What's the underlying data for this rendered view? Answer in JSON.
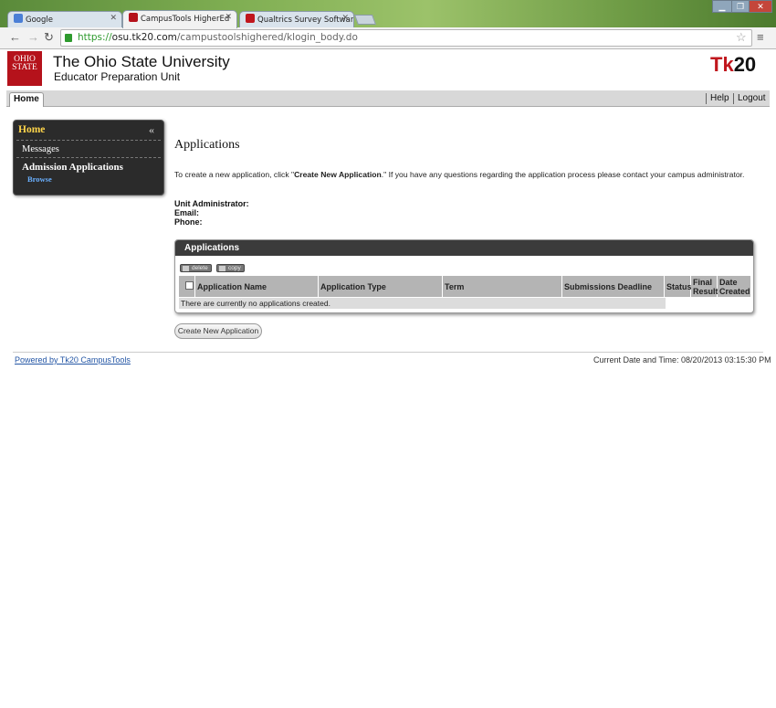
{
  "browser": {
    "tabs": [
      {
        "label": "Google",
        "icon": "google-icon",
        "color": "#4a7fd6"
      },
      {
        "label": "CampusTools HigherEd",
        "icon": "feather-icon",
        "color": "#b5121b"
      },
      {
        "label": "Qualtrics Survey Software",
        "icon": "qualtrics-icon",
        "color": "#c0161d"
      }
    ],
    "url_scheme": "https://",
    "url_host": "osu.tk20.com",
    "url_path": "/campustoolshighered/klogin_body.do"
  },
  "header": {
    "logo_text": "OHIO STATE",
    "university": "The Ohio State University",
    "unit": "Educator Preparation Unit",
    "brand_tk": "Tk",
    "brand_20": "20"
  },
  "menubar": {
    "home_tab": "Home",
    "help": "Help",
    "logout": "Logout"
  },
  "sidebar": {
    "home": "Home",
    "messages": "Messages",
    "admission": "Admission Applications",
    "browse": "Browse"
  },
  "main": {
    "heading": "Applications",
    "intro_before": "To create a new application, click \"",
    "intro_bold": "Create New Application",
    "intro_after": ".\" If you have any questions regarding the application process please contact your campus administrator.",
    "unit_admin": "Unit Administrator:",
    "email": "Email:",
    "phone": "Phone:"
  },
  "applications_box": {
    "title": "Applications",
    "delete_label": "delete",
    "copy_label": "copy",
    "columns": [
      "Application Name",
      "Application Type",
      "Term",
      "Submissions Deadline",
      "Status",
      "Final Result",
      "Date Created"
    ],
    "empty_message": "There are currently no applications created."
  },
  "create_button": "Create New Application",
  "footer": {
    "powered": "Powered by Tk20 CampusTools",
    "datetime": "Current Date and Time: 08/20/2013 03:15:30 PM"
  }
}
